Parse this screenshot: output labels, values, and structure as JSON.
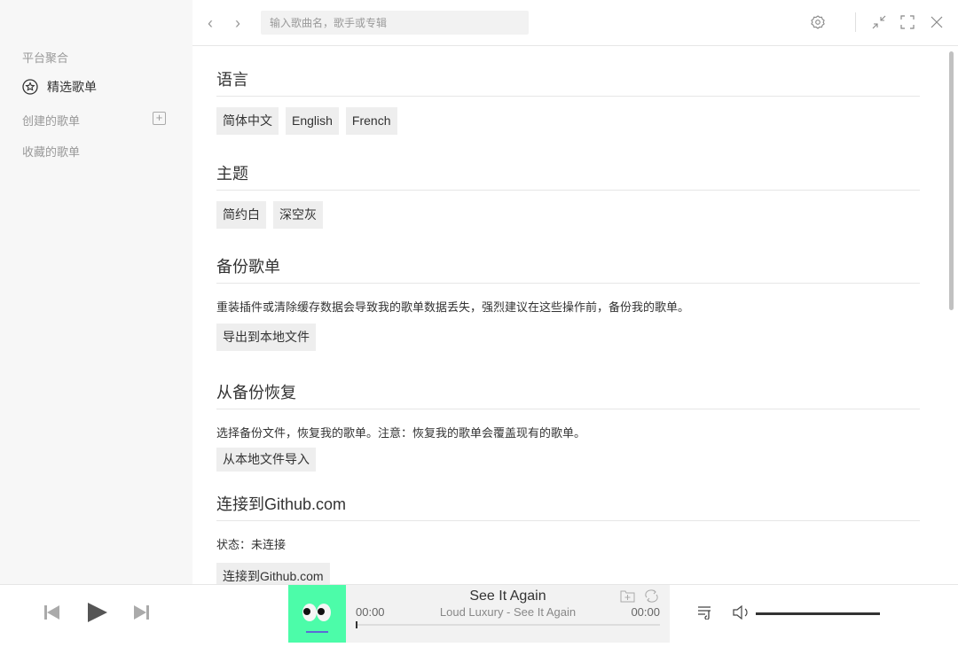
{
  "sidebar": {
    "platform_title": "平台聚合",
    "featured": "精选歌单",
    "created_title": "创建的歌单",
    "collected_title": "收藏的歌单"
  },
  "header": {
    "search_placeholder": "输入歌曲名，歌手或专辑",
    "back": "‹",
    "forward": "›"
  },
  "settings": {
    "language": {
      "title": "语言",
      "options": [
        "简体中文",
        "English",
        "French"
      ],
      "selected": "简体中文"
    },
    "theme": {
      "title": "主题",
      "options": [
        "简约白",
        "深空灰"
      ]
    },
    "backup": {
      "title": "备份歌单",
      "desc": "重装插件或清除缓存数据会导致我的歌单数据丢失，强烈建议在这些操作前，备份我的歌单。",
      "button": "导出到本地文件"
    },
    "restore": {
      "title": "从备份恢复",
      "desc": "选择备份文件，恢复我的歌单。注意：恢复我的歌单会覆盖现有的歌单。",
      "button": "从本地文件导入"
    },
    "github": {
      "title": "连接到Github.com",
      "status": "状态：未连接",
      "button": "连接到Github.com"
    }
  },
  "player": {
    "title": "See It Again",
    "subtitle": "Loud Luxury - See It Again",
    "current_time": "00:00",
    "duration": "00:00",
    "progress": 0,
    "volume": 1,
    "cover_color": "#4cfca9"
  }
}
